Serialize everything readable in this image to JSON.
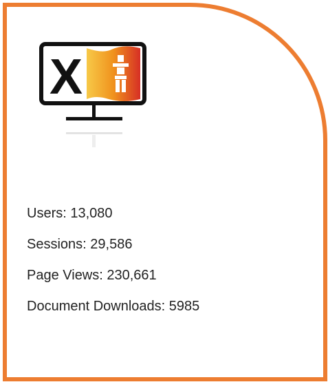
{
  "colors": {
    "border": "#ed7d31",
    "text": "#222222",
    "logo_red": "#d62f25",
    "logo_orange": "#f0921d",
    "logo_yellow": "#f7c948"
  },
  "logo": {
    "icon": "monitor-logo-icon",
    "letter": "X"
  },
  "stats": [
    {
      "label": "Users",
      "value": "13,080",
      "text": "Users: 13,080"
    },
    {
      "label": "Sessions",
      "value": "29,586",
      "text": "Sessions: 29,586"
    },
    {
      "label": "Page Views",
      "value": "230,661",
      "text": "Page Views: 230,661"
    },
    {
      "label": "Document Downloads",
      "value": "5985",
      "text": "Document Downloads: 5985"
    }
  ]
}
